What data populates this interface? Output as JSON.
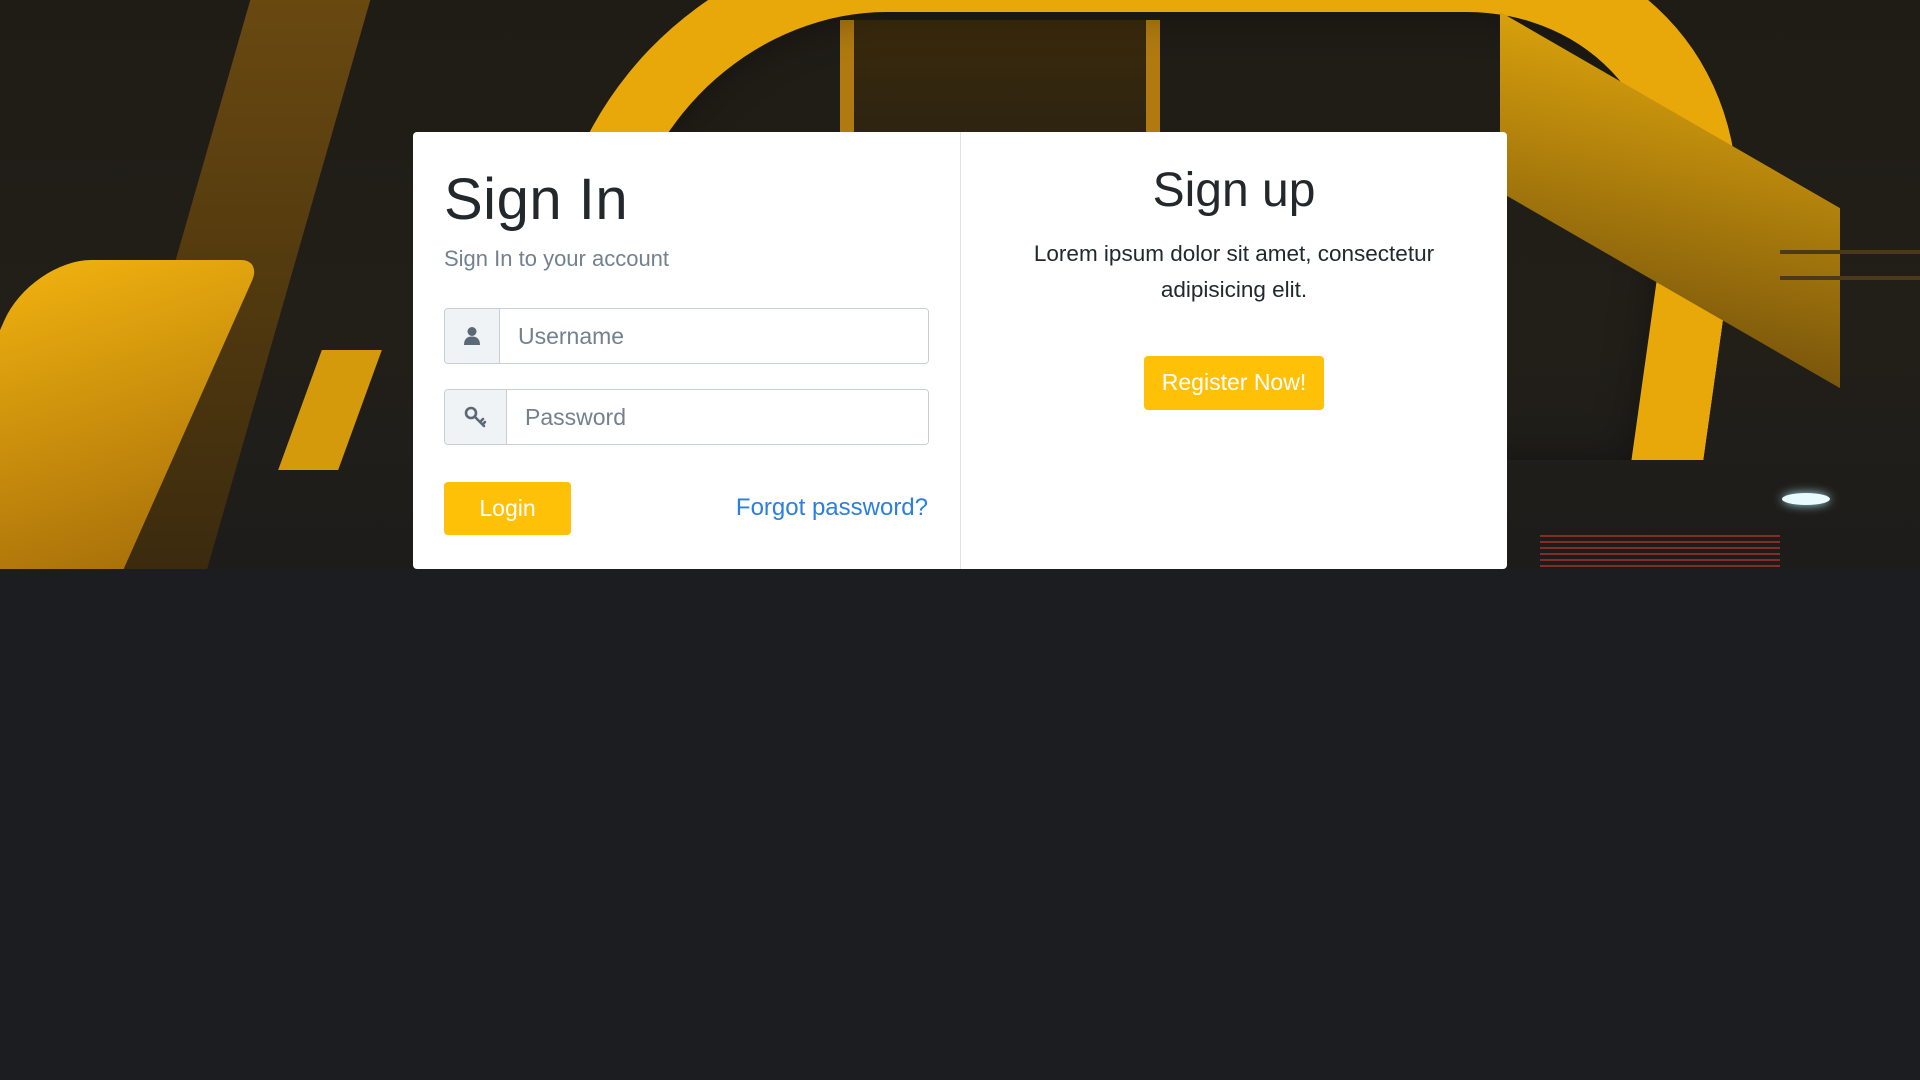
{
  "signin": {
    "title": "Sign In",
    "subtitle": "Sign In to your account",
    "username_placeholder": "Username",
    "password_placeholder": "Password",
    "login_label": "Login",
    "forgot_label": "Forgot password?",
    "username_icon": "user-icon",
    "password_icon": "key-icon"
  },
  "signup": {
    "title": "Sign up",
    "text": "Lorem ipsum dolor sit amet, consectetur adipisicing elit.",
    "register_label": "Register Now!"
  },
  "colors": {
    "accent": "#ffc107",
    "link": "#2a7fe0",
    "background": "#1b1d20"
  }
}
